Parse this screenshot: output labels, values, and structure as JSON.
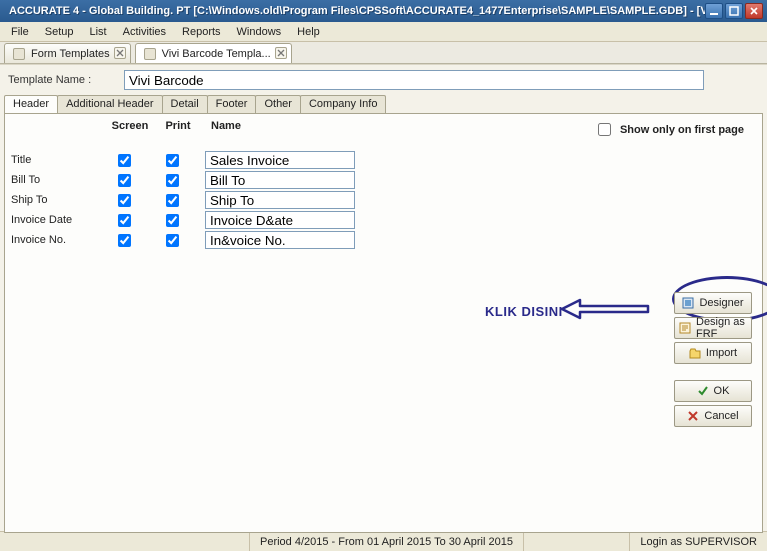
{
  "window": {
    "title": "ACCURATE 4 - Global Building. PT   [C:\\Windows.old\\Program Files\\CPSSoft\\ACCURATE4_1477Enterprise\\SAMPLE\\SAMPLE.GDB] - [Vivi Barcode Template field selection]"
  },
  "menu": [
    "File",
    "Setup",
    "List",
    "Activities",
    "Reports",
    "Windows",
    "Help"
  ],
  "mdi_tabs": [
    {
      "label": "Form Templates"
    },
    {
      "label": "Vivi Barcode Templa..."
    }
  ],
  "template_name": {
    "label": "Template Name :",
    "value": "Vivi Barcode"
  },
  "section_tabs": [
    "Header",
    "Additional Header",
    "Detail",
    "Footer",
    "Other",
    "Company Info"
  ],
  "columns": {
    "screen": "Screen",
    "print": "Print",
    "name": "Name"
  },
  "show_only": {
    "label": "Show only on first page",
    "checked": false
  },
  "fields": [
    {
      "label": "Title",
      "screen": true,
      "print": true,
      "name": "Sales Invoice"
    },
    {
      "label": "Bill To",
      "screen": true,
      "print": true,
      "name": "Bill To"
    },
    {
      "label": "Ship To",
      "screen": true,
      "print": true,
      "name": "Ship To"
    },
    {
      "label": "Invoice Date",
      "screen": true,
      "print": true,
      "name": "Invoice D&ate"
    },
    {
      "label": "Invoice No.",
      "screen": true,
      "print": true,
      "name": "In&voice No."
    }
  ],
  "annotation": {
    "text": "KLIK DISINI"
  },
  "buttons": {
    "designer": "Designer",
    "design_frf": "Design as FRF",
    "import": "Import",
    "ok": "OK",
    "cancel": "Cancel"
  },
  "status": {
    "period": "Period 4/2015 - From 01 April 2015 To 30 April 2015",
    "login": "Login as SUPERVISOR"
  }
}
